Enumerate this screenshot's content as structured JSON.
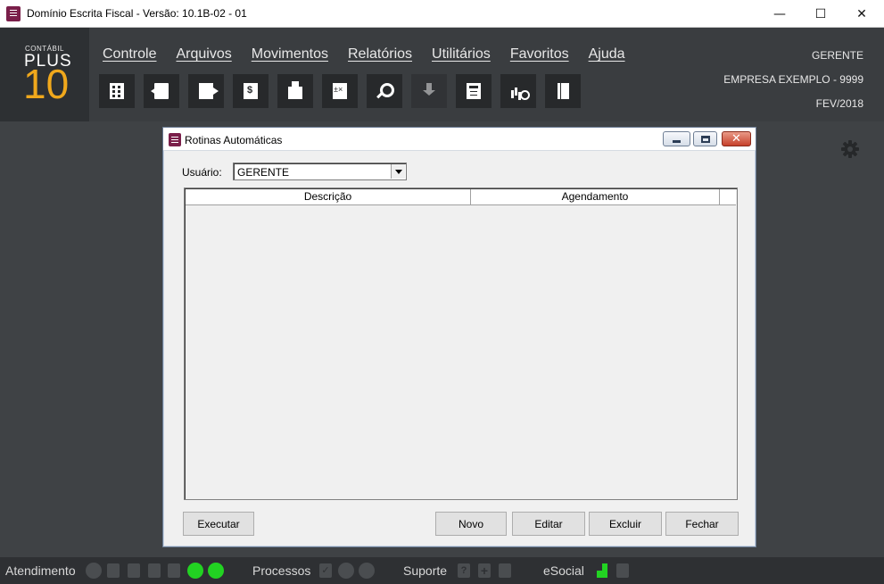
{
  "window": {
    "title": "Domínio Escrita Fiscal  - Versão: 10.1B-02 - 01",
    "minimize_glyph": "—",
    "maximize_glyph": "☐",
    "close_glyph": "✕"
  },
  "logo": {
    "small": "CONTÁBIL",
    "plus": "PLUS",
    "number": "10",
    "accent_color": "#f0a81c"
  },
  "menu": [
    {
      "label": "Controle"
    },
    {
      "label": "Arquivos"
    },
    {
      "label": "Movimentos"
    },
    {
      "label": "Relatórios"
    },
    {
      "label": "Utilitários"
    },
    {
      "label": "Favoritos"
    },
    {
      "label": "Ajuda"
    }
  ],
  "toolbar_icons": [
    "building-icon",
    "document-import-icon",
    "document-export-icon",
    "document-money-icon",
    "printer-icon",
    "calculator-operations-icon",
    "search-icon",
    "download-icon",
    "calculator-icon",
    "chart-search-icon",
    "book-icon"
  ],
  "user_info": {
    "user": "GERENTE",
    "company": "EMPRESA EXEMPLO     - 9999",
    "period": "FEV/2018"
  },
  "dialog": {
    "title": "Rotinas Automáticas",
    "user_label": "Usuário:",
    "user_value": "GERENTE",
    "columns": [
      "Descrição",
      "Agendamento"
    ],
    "rows": [],
    "buttons": {
      "execute": "Executar",
      "new": "Novo",
      "edit": "Editar",
      "delete": "Excluir",
      "close": "Fechar"
    },
    "close_glyph": "✕"
  },
  "statusbar": {
    "attendance": "Atendimento",
    "processes": "Processos",
    "support": "Suporte",
    "esocial": "eSocial",
    "help_glyph": "?",
    "plus_glyph": "+",
    "check_glyph": "✓",
    "status_color": "#22d322"
  }
}
